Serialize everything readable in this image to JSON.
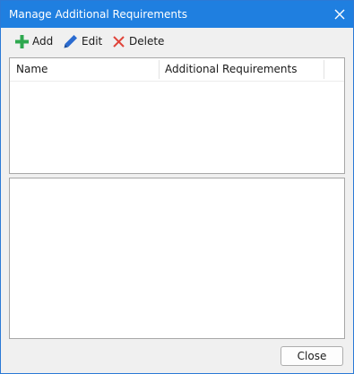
{
  "window": {
    "title": "Manage Additional Requirements",
    "close_icon": "close-icon"
  },
  "toolbar": {
    "add": {
      "label": "Add",
      "icon": "plus-icon",
      "color": "#2ea84f"
    },
    "edit": {
      "label": "Edit",
      "icon": "pencil-icon",
      "color": "#2a6bd0"
    },
    "delete": {
      "label": "Delete",
      "icon": "x-icon",
      "color": "#e0443a"
    }
  },
  "grid": {
    "columns": [
      "Name",
      "Additional Requirements"
    ],
    "rows": []
  },
  "footer": {
    "close_label": "Close"
  },
  "colors": {
    "titlebar": "#1f7fe0",
    "accent_border": "#2b7ad6"
  }
}
